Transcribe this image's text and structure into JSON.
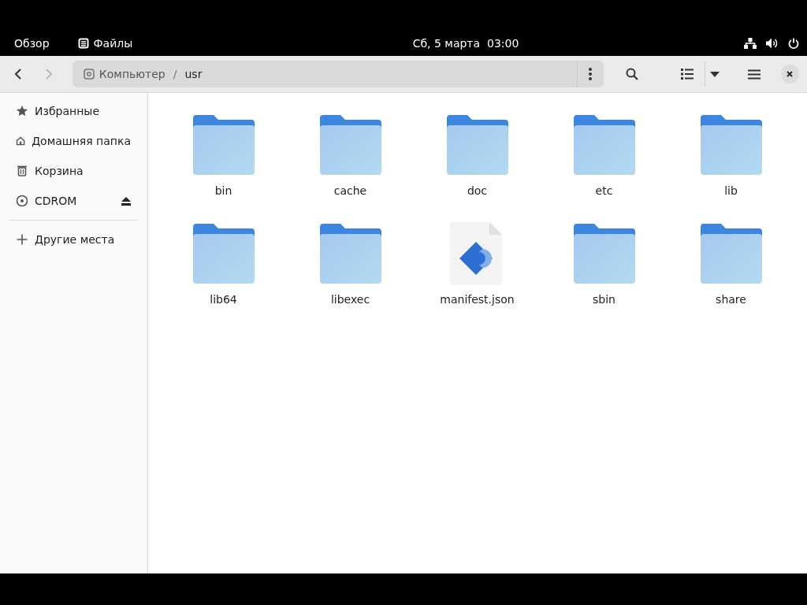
{
  "top_bar": {
    "activities": "Обзор",
    "app": "Файлы",
    "clock": "Сб, 5 марта  03:00"
  },
  "header_bar": {
    "path": [
      {
        "label": "Компьютер",
        "kind": "drive"
      },
      {
        "label": "/",
        "kind": "separator"
      },
      {
        "label": "usr",
        "kind": "folder"
      }
    ],
    "back_disabled": false,
    "forward_disabled": true
  },
  "sidebar": {
    "items": [
      {
        "label": "Избранные",
        "kind": "star",
        "selected": false
      },
      {
        "label": "Домашняя папка",
        "kind": "home",
        "selected": false
      },
      {
        "label": "Корзина",
        "kind": "trash",
        "selected": false
      },
      {
        "label": "CDROM",
        "kind": "disc",
        "selected": false
      },
      {
        "label": "Другие места",
        "kind": "plus",
        "selected": false
      }
    ]
  },
  "files": [
    {
      "name": "bin",
      "kind": "folder"
    },
    {
      "name": "cache",
      "kind": "folder"
    },
    {
      "name": "doc",
      "kind": "folder"
    },
    {
      "name": "etc",
      "kind": "folder"
    },
    {
      "name": "lib",
      "kind": "folder"
    },
    {
      "name": "lib64",
      "kind": "folder"
    },
    {
      "name": "libexec",
      "kind": "folder"
    },
    {
      "name": "manifest.json",
      "kind": "file"
    },
    {
      "name": "sbin",
      "kind": "folder"
    },
    {
      "name": "share",
      "kind": "folder"
    }
  ]
}
